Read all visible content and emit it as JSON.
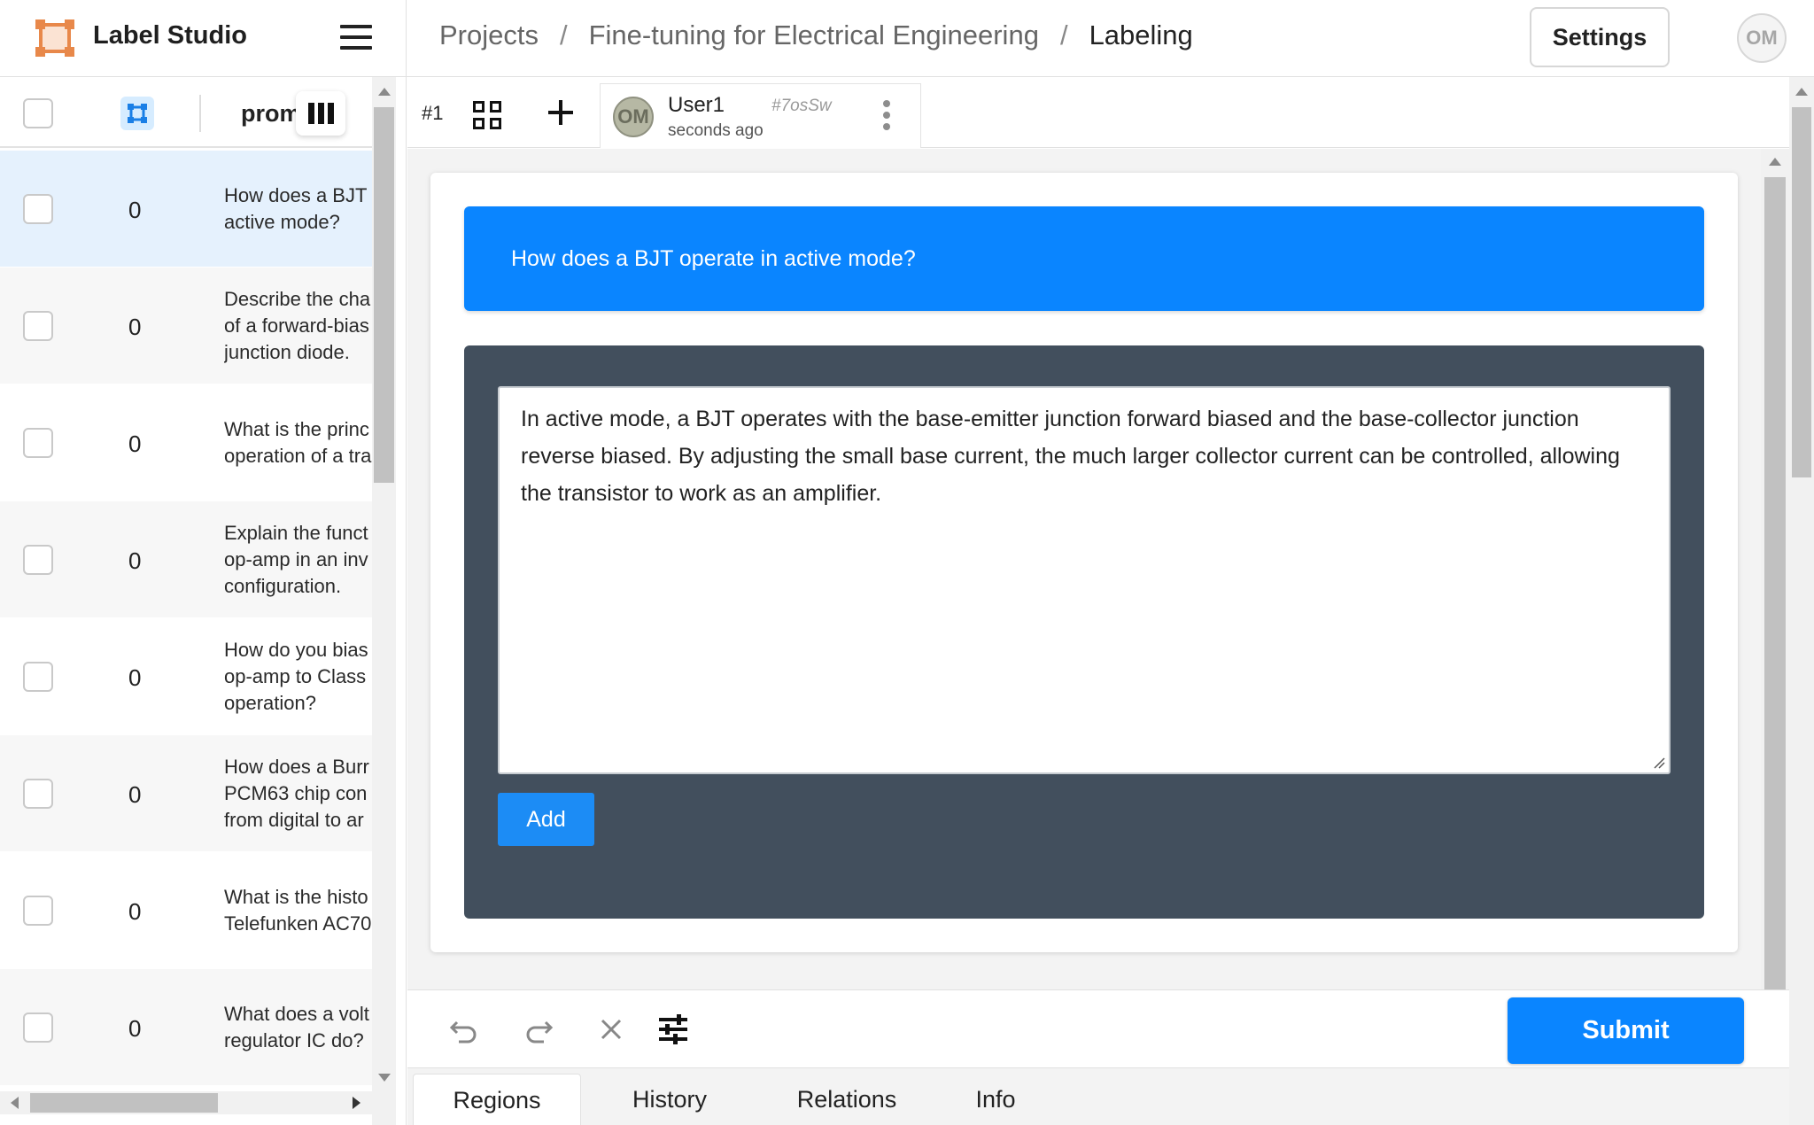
{
  "app": {
    "name": "Label Studio",
    "user_initials": "OM"
  },
  "breadcrumb": {
    "projects": "Projects",
    "separator": "/",
    "project": "Fine-tuning for Electrical Engineering",
    "current": "Labeling"
  },
  "header": {
    "settings_label": "Settings"
  },
  "task_list": {
    "column_header": "prom",
    "rows": [
      {
        "count": "0",
        "prompt": "How does a BJT\nactive mode?",
        "selected": true
      },
      {
        "count": "0",
        "prompt": "Describe the cha\nof a forward-bias\njunction diode."
      },
      {
        "count": "0",
        "prompt": "What is the princ\noperation of a tra"
      },
      {
        "count": "0",
        "prompt": "Explain the funct\nop-amp in an inv\nconfiguration."
      },
      {
        "count": "0",
        "prompt": "How do you bias\nop-amp to Class\noperation?"
      },
      {
        "count": "0",
        "prompt": "How does a Burr\nPCM63 chip con\nfrom digital to ar"
      },
      {
        "count": "0",
        "prompt": "What is the histo\nTelefunken AC70"
      },
      {
        "count": "0",
        "prompt": "What does a volt\nregulator IC do?"
      }
    ]
  },
  "annotation": {
    "number": "#1",
    "user": "User1",
    "id": "#7osSw",
    "time": "seconds ago",
    "avatar_initials": "OM"
  },
  "content": {
    "question": "How does a BJT operate in active mode?",
    "answer": "In active mode, a BJT operates with the base-emitter junction forward biased and the base-collector junction reverse biased. By adjusting the small base current, the much larger collector current can be controlled, allowing the transistor to work as an amplifier.",
    "add_label": "Add"
  },
  "toolbar": {
    "submit_label": "Submit"
  },
  "bottom_tabs": [
    "Regions",
    "History",
    "Relations",
    "Info"
  ],
  "colors": {
    "accent": "#0a85ff",
    "answer_bg": "#424f5d",
    "logo": "#e8884a",
    "selected_row": "#e5f1fd"
  }
}
